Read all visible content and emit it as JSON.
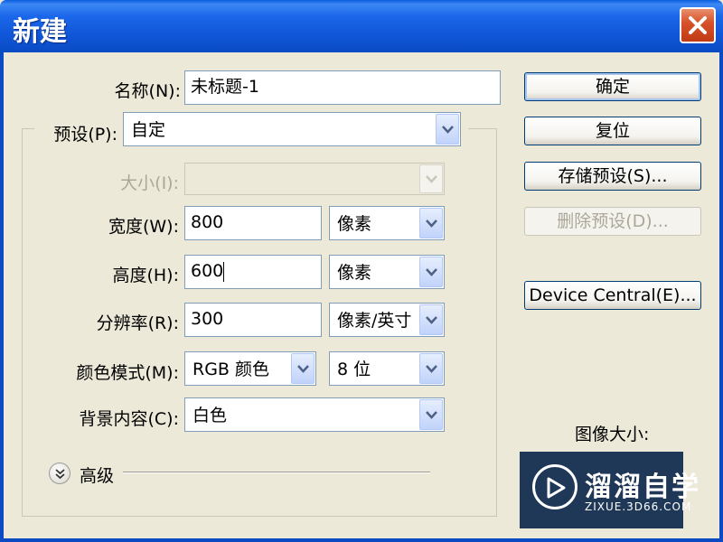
{
  "window": {
    "title": "新建"
  },
  "form": {
    "name": {
      "label": "名称(N):",
      "value": "未标题-1"
    },
    "preset": {
      "label": "预设(P):",
      "value": "自定"
    },
    "size": {
      "label": "大小(I):",
      "value": ""
    },
    "width": {
      "label": "宽度(W):",
      "value": "800",
      "unit": "像素"
    },
    "height": {
      "label": "高度(H):",
      "value": "600",
      "unit": "像素"
    },
    "resolution": {
      "label": "分辨率(R):",
      "value": "300",
      "unit": "像素/英寸"
    },
    "color_mode": {
      "label": "颜色模式(M):",
      "value": "RGB 颜色",
      "depth": "8 位"
    },
    "background": {
      "label": "背景内容(C):",
      "value": "白色"
    },
    "advanced": {
      "label": "高级"
    }
  },
  "buttons": {
    "ok": "确定",
    "reset": "复位",
    "save_preset": "存储预设(S)...",
    "delete_preset": "删除预设(D)...",
    "device_central": "Device Central(E)..."
  },
  "image_size": {
    "label": "图像大小:"
  },
  "watermark": {
    "title": "溜溜自学",
    "url": "ZIXUE.3D66.COM"
  },
  "colors": {
    "titlebar": "#0A5BE0",
    "close": "#D8532C",
    "dialog_bg": "#ECE9D8"
  }
}
